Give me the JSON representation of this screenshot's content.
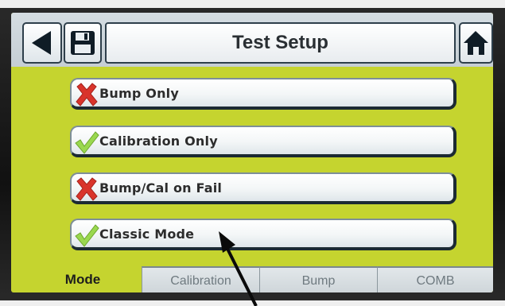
{
  "header": {
    "title": "Test Setup",
    "back_icon": "back-arrow-icon",
    "save_icon": "floppy-disk-icon",
    "home_icon": "home-icon"
  },
  "options": [
    {
      "label": "Bump Only",
      "state": "disabled",
      "icon": "red-x-icon"
    },
    {
      "label": "Calibration Only",
      "state": "enabled",
      "icon": "green-check-icon"
    },
    {
      "label": "Bump/Cal on Fail",
      "state": "disabled",
      "icon": "red-x-icon"
    },
    {
      "label": "Classic Mode",
      "state": "enabled",
      "icon": "green-check-icon"
    }
  ],
  "tabs": [
    {
      "label": "Mode",
      "active": true
    },
    {
      "label": "Calibration",
      "active": false
    },
    {
      "label": "Bump",
      "active": false
    },
    {
      "label": "COMB",
      "active": false
    }
  ],
  "colors": {
    "screen_background": "#c5d42f",
    "header_background": "#d0d8dd",
    "button_border": "#2e3f4b",
    "x_red": "#d9342b",
    "check_green": "#8fcf4a"
  }
}
